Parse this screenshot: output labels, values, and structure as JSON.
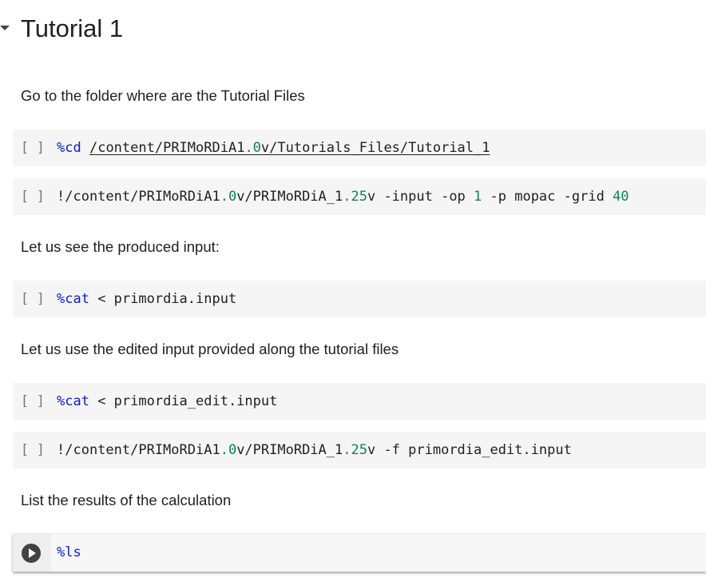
{
  "section": {
    "title": "Tutorial 1"
  },
  "cells": {
    "text1": "Go to the folder where are the Tutorial Files",
    "code1": {
      "bracket": "[ ]",
      "magic": "%cd",
      "sp": " ",
      "p1": "/content/PRIMoRDiA1",
      "n1": ".0",
      "p2": "v/Tutorials_Files/Tutorial_1"
    },
    "code2": {
      "bracket": "[ ]",
      "p1": "!/content/PRIMoRDiA1",
      "n1": ".0",
      "p2": "v/PRIMoRDiA_1",
      "n2": ".25",
      "p3": "v -input -op ",
      "n3": "1",
      "p4": " -p mopac -grid ",
      "n4": "40"
    },
    "text2": "Let us see the produced input:",
    "code3": {
      "bracket": "[ ]",
      "magic": "%cat",
      "rest": " < primordia.input"
    },
    "text3": "Let us use the edited input provided along the tutorial files",
    "code4": {
      "bracket": "[ ]",
      "magic": "%cat",
      "rest": " < primordia_edit.input"
    },
    "code5": {
      "bracket": "[ ]",
      "p1": "!/content/PRIMoRDiA1",
      "n1": ".0",
      "p2": "v/PRIMoRDiA_1",
      "n2": ".25",
      "p3": "v -f primordia_edit.input"
    },
    "text4": "List the results of the calculation",
    "code6": {
      "code": "%ls"
    }
  },
  "icons": {
    "collapse": "caret-down-icon",
    "run": "play-icon"
  },
  "colors": {
    "magic": "#0d21c9",
    "number": "#098658",
    "cell_bg": "#f5f5f5"
  }
}
